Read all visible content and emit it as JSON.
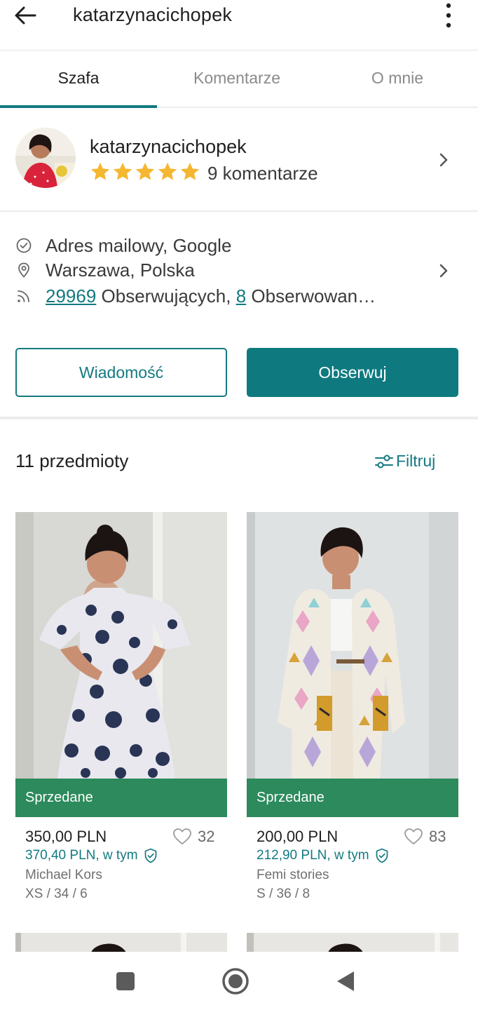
{
  "header": {
    "title": "katarzynacichopek"
  },
  "tabs": [
    {
      "label": "Szafa",
      "active": true
    },
    {
      "label": "Komentarze",
      "active": false
    },
    {
      "label": "O mnie",
      "active": false
    }
  ],
  "profile": {
    "username": "katarzynacichopek",
    "rating_stars": 5,
    "reviews_label": "9 komentarze"
  },
  "info": {
    "verified": "Adres mailowy, Google",
    "location": "Warszawa, Polska",
    "followers_count": "29969",
    "followers_label": " Obserwujących, ",
    "following_count": "8",
    "following_label": " Obserwowan…"
  },
  "buttons": {
    "message": "Wiadomość",
    "follow": "Obserwuj"
  },
  "wardrobe": {
    "count_label": "11 przedmioty",
    "filter_label": "Filtruj"
  },
  "items": [
    {
      "status": "Sprzedane",
      "price": "350,00 PLN",
      "favorites": "32",
      "price_total": "370,40 PLN, w tym",
      "brand": "Michael Kors",
      "size": "XS / 34 / 6"
    },
    {
      "status": "Sprzedane",
      "price": "200,00 PLN",
      "favorites": "83",
      "price_total": "212,90 PLN, w tym",
      "brand": "Femi stories",
      "size": "S / 36 / 8"
    }
  ],
  "colors": {
    "accent": "#137a80",
    "sold": "#2c8a5c",
    "star": "#f5b731"
  },
  "icons": [
    "back-arrow-icon",
    "more-vert-icon",
    "star-icon",
    "chevron-right-icon",
    "check-circle-icon",
    "location-pin-icon",
    "rss-icon",
    "filter-sliders-icon",
    "heart-icon",
    "shield-check-icon",
    "square-icon",
    "circle-home-icon",
    "triangle-back-icon"
  ]
}
